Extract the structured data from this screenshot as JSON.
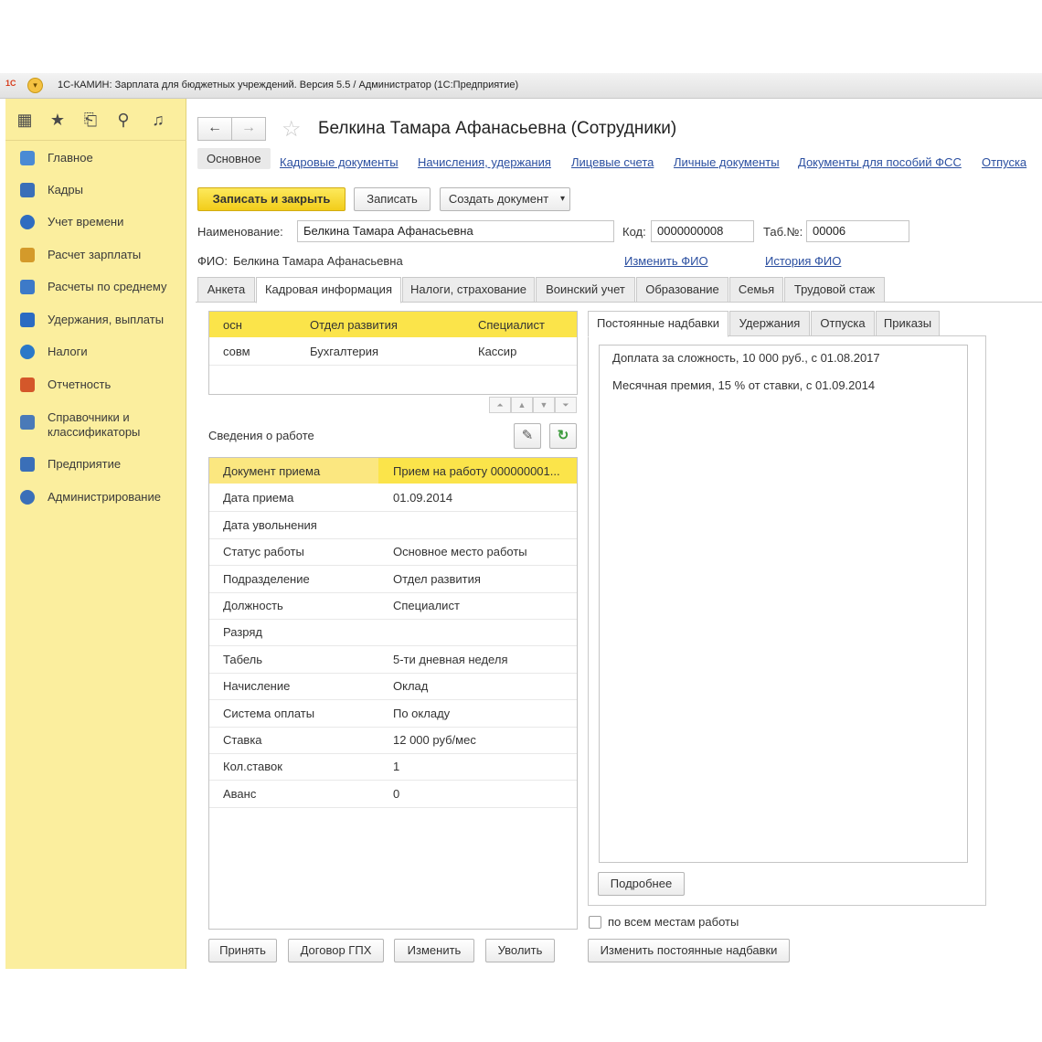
{
  "window": {
    "logo": "1С",
    "title": "1С-КАМИН: Зарплата для бюджетных учреждений. Версия 5.5 / Администратор  (1С:Предприятие)"
  },
  "sidebar": {
    "top_icons": [
      "grid-icon",
      "star-icon",
      "history-icon",
      "search-icon",
      "bell-icon"
    ],
    "items": [
      {
        "label": "Главное",
        "icon": "home-icon",
        "color": "#4a8ad4"
      },
      {
        "label": "Кадры",
        "icon": "people-icon",
        "color": "#3a6fb8"
      },
      {
        "label": "Учет времени",
        "icon": "clock-icon",
        "color": "#2f6cc0"
      },
      {
        "label": "Расчет зарплаты",
        "icon": "calculator-icon",
        "color": "#d49a2a"
      },
      {
        "label": "Расчеты по среднему",
        "icon": "chart-icon",
        "color": "#3d7ac8"
      },
      {
        "label": "Удержания, выплаты",
        "icon": "wallet-icon",
        "color": "#2a6bc2"
      },
      {
        "label": "Налоги",
        "icon": "tax-icon",
        "color": "#2a78c8"
      },
      {
        "label": "Отчетность",
        "icon": "report-icon",
        "color": "#d4572a"
      },
      {
        "label": "Справочники и классификаторы",
        "label_line1": "Справочники и",
        "label_line2": "классификаторы",
        "icon": "book-icon",
        "color": "#4a7ab8"
      },
      {
        "label": "Предприятие",
        "icon": "factory-icon",
        "color": "#3a6fb8"
      },
      {
        "label": "Администрирование",
        "icon": "settings-icon",
        "color": "#3a6fb8"
      }
    ]
  },
  "header": {
    "back": "←",
    "forward": "→",
    "title": "Белкина Тамара Афанасьевна (Сотрудники)"
  },
  "link_tabs": [
    "Основное",
    "Кадровые документы",
    "Начисления, удержания",
    "Лицевые счета",
    "Личные документы",
    "Документы для пособий ФСС",
    "Отпуска"
  ],
  "toolbar": {
    "save_close": "Записать и закрыть",
    "save": "Записать",
    "create_doc": "Создать документ",
    "dropdown_arrow": "▾"
  },
  "form": {
    "name_label": "Наименование:",
    "name_value": "Белкина Тамара Афанасьевна",
    "code_label": "Код:",
    "code_value": "0000000008",
    "tab_label": "Таб.№:",
    "tab_value": "00006",
    "fio_label": "ФИО:",
    "fio_value": "Белкина Тамара Афанасьевна",
    "change_fio": "Изменить ФИО",
    "history_fio": "История ФИО"
  },
  "tabs": [
    "Анкета",
    "Кадровая информация",
    "Налоги, страхование",
    "Воинский учет",
    "Образование",
    "Семья",
    "Трудовой стаж"
  ],
  "positions": [
    {
      "type": "осн",
      "dept": "Отдел развития",
      "post": "Специалист"
    },
    {
      "type": "совм",
      "dept": "Бухгалтерия",
      "post": "Кассир"
    }
  ],
  "work_info": {
    "title": "Сведения о работе",
    "rows": [
      {
        "k": "Документ приема",
        "v": "Прием на работу 000000001..."
      },
      {
        "k": "Дата приема",
        "v": "01.09.2014"
      },
      {
        "k": "Дата увольнения",
        "v": ""
      },
      {
        "k": "Статус работы",
        "v": "Основное место работы"
      },
      {
        "k": "Подразделение",
        "v": "Отдел развития"
      },
      {
        "k": "Должность",
        "v": "Специалист"
      },
      {
        "k": "Разряд",
        "v": ""
      },
      {
        "k": "Табель",
        "v": "5-ти дневная неделя"
      },
      {
        "k": "Начисление",
        "v": "Оклад"
      },
      {
        "k": "Система оплаты",
        "v": "По окладу"
      },
      {
        "k": "Ставка",
        "v": "12 000 руб/мес"
      },
      {
        "k": "Кол.ставок",
        "v": "1"
      },
      {
        "k": "Аванс",
        "v": "0"
      }
    ]
  },
  "left_buttons": [
    "Принять",
    "Договор ГПХ",
    "Изменить",
    "Уволить"
  ],
  "right_tabs": [
    "Постоянные надбавки",
    "Удержания",
    "Отпуска",
    "Приказы"
  ],
  "allowances": [
    "Доплата за сложность, 10 000 руб., с 01.08.2017",
    "Месячная премия, 15 % от ставки, с 01.09.2014"
  ],
  "more_btn": "Подробнее",
  "all_places_label": "по всем местам работы",
  "change_allowances_btn": "Изменить постоянные надбавки"
}
